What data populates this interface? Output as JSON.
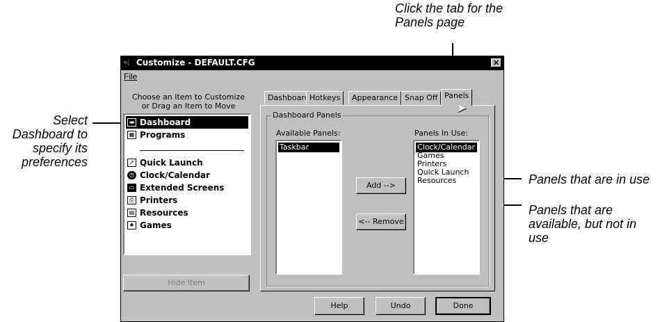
{
  "callouts": {
    "top": [
      "Click the tab for the",
      "Panels page"
    ],
    "left": [
      "Select",
      "Dashboard to",
      "specify its",
      "preferences"
    ],
    "in_use": "Panels that are in use",
    "available": [
      "Panels that are",
      "available, but not in",
      "use"
    ]
  },
  "window": {
    "title": "Customize - DEFAULT.CFG",
    "close": "✕",
    "menu_file": "File"
  },
  "left_panel": {
    "instruction_line1": "Choose an Item to Customize",
    "instruction_line2": "or Drag an Item to Move",
    "items": [
      {
        "label": "Dashboard",
        "icon": "dashboard-icon",
        "selected": true
      },
      {
        "label": "Programs",
        "icon": "programs-icon"
      },
      {
        "label": "Quick Launch",
        "icon": "quick-launch-icon"
      },
      {
        "label": "Clock/Calendar",
        "icon": "clock-icon"
      },
      {
        "label": "Extended Screens",
        "icon": "screens-icon"
      },
      {
        "label": "Printers",
        "icon": "printer-icon"
      },
      {
        "label": "Resources",
        "icon": "resources-icon"
      },
      {
        "label": "Games",
        "icon": "games-icon"
      }
    ],
    "hide_button": "Hide Item"
  },
  "tabs": [
    "Dashboard",
    "Hotkeys",
    "Appearance",
    "Snap Off",
    "Panels"
  ],
  "group": {
    "title": "Dashboard Panels",
    "available_label": "Available Panels:",
    "in_use_label": "Panels In Use:",
    "available": [
      "Taskbar"
    ],
    "in_use": [
      "Clock/Calendar",
      "Games",
      "Printers",
      "Quick Launch",
      "Resources"
    ],
    "add_button": "Add -->",
    "remove_button": "<-- Remove"
  },
  "buttons": {
    "help": "Help",
    "undo": "Undo",
    "done": "Done"
  },
  "colors": {
    "selection": "#000000",
    "face": "#c0c0c0"
  }
}
